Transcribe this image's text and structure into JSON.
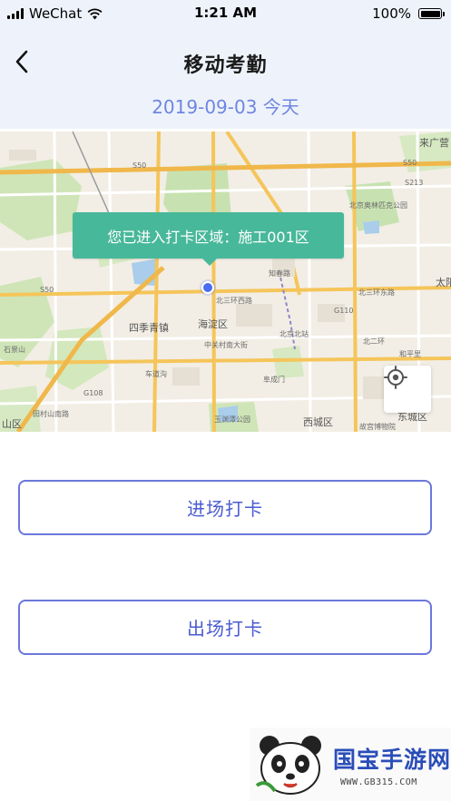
{
  "status_bar": {
    "carrier": "WeChat",
    "time": "1:21 AM",
    "battery_percent": "100%",
    "battery_level": 1.0
  },
  "nav": {
    "back_icon": "chevron-left-icon",
    "title": "移动考勤",
    "date": "2019-09-03 今天"
  },
  "map": {
    "geofence_tip": "您已进入打卡区域：施工001区",
    "locate_icon": "crosshair-icon",
    "labels": {
      "haidian": "海淀区",
      "sijiqing": "四季青镇",
      "xicheng": "西城区",
      "dongcheng": "东城区",
      "shanqu": "山区",
      "taiyang": "太阳",
      "laiguang": "来广营",
      "beijing_north": "北京北站",
      "olympic_park": "北京奥林匹克公园",
      "north3ring_west": "北三环西路",
      "north3ring_mid": "北三环中路",
      "north3ring_east": "北三环东路",
      "zhichun": "知春路",
      "north_ring_east": "北二环",
      "yuyuantan": "玉渊潭公园",
      "gugong": "故宫博物院",
      "hepingli": "和平里",
      "s50_a": "S50",
      "s50_b": "S50",
      "s213": "S213",
      "g108": "G108",
      "g110": "G110",
      "tiancun": "田村山南路",
      "fuchengmen": "阜成门",
      "zhongguancun": "中关村南大街",
      "chedaogou": "车道沟",
      "shijingshan": "石景山"
    }
  },
  "actions": {
    "check_in": "进场打卡",
    "check_out": "出场打卡"
  },
  "watermark": {
    "brand": "国宝手游网",
    "url": "WWW.GB315.COM",
    "mascot_icon": "panda-icon"
  },
  "colors": {
    "header_bg": "#eef3fb",
    "accent": "#6f86e0",
    "tip_green": "#48b89a",
    "button_border": "#6a78dc",
    "button_text": "#4a5bd0"
  }
}
